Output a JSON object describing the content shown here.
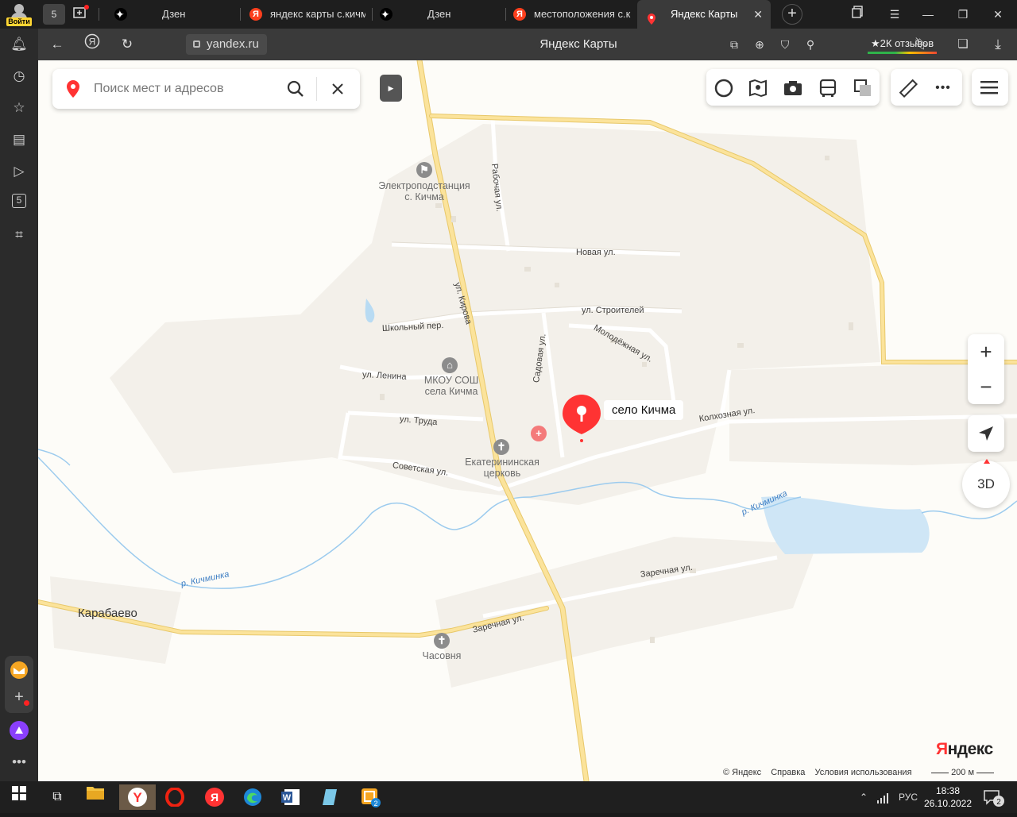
{
  "browser": {
    "profile": {
      "login_label": "Войти"
    },
    "tab_counter": "5",
    "tabs": [
      {
        "title": "Дзен",
        "favicon": "dzen-icon"
      },
      {
        "title": "яндекс карты с.кичм",
        "favicon": "yandex-icon"
      },
      {
        "title": "Дзен",
        "favicon": "dzen-icon"
      },
      {
        "title": "местоположения с.к",
        "favicon": "yandex-icon"
      },
      {
        "title": "Яндекс Карты",
        "favicon": "yandex-maps-icon",
        "active": true
      }
    ],
    "address": {
      "url": "yandex.ru",
      "page_title": "Яндекс Карты",
      "reviews": "★2К отзывов"
    },
    "sidebar_counter": "5"
  },
  "map": {
    "search": {
      "placeholder": "Поиск мест и адресов"
    },
    "selected_place": "село Кичма",
    "zoom_in": "+",
    "zoom_out": "−",
    "mode_3d": "3D",
    "streets": [
      {
        "id": "rabochaya",
        "label": "Рабочая ул."
      },
      {
        "id": "novaya",
        "label": "Новая ул."
      },
      {
        "id": "kirova",
        "label": "ул. Кирова"
      },
      {
        "id": "stroiteley",
        "label": "ул. Строителей"
      },
      {
        "id": "shkolny",
        "label": "Школьный пер."
      },
      {
        "id": "molodezhnaya",
        "label": "Молодёжная ул."
      },
      {
        "id": "sadovaya",
        "label": "Садовая ул."
      },
      {
        "id": "lenina",
        "label": "ул. Ленина"
      },
      {
        "id": "truda",
        "label": "ул. Труда"
      },
      {
        "id": "kolkhoznaya",
        "label": "Колхозная ул."
      },
      {
        "id": "sovetskaya",
        "label": "Советская ул."
      },
      {
        "id": "zarechnaya1",
        "label": "Заречная ул."
      },
      {
        "id": "zarechnaya2",
        "label": "Заречная ул."
      }
    ],
    "rivers": [
      {
        "id": "kichminka1",
        "label": "р. Кичминка"
      },
      {
        "id": "kichminka2",
        "label": "р. Кичминка"
      }
    ],
    "pois": [
      {
        "id": "substation",
        "line1": "Электроподстанция",
        "line2": "с. Кичма",
        "icon": "flag-icon"
      },
      {
        "id": "school",
        "line1": "МКОУ СОШ",
        "line2": "села Кичма",
        "icon": "school-icon"
      },
      {
        "id": "church",
        "line1": "Екатерининская",
        "line2": "церковь",
        "icon": "church-icon"
      },
      {
        "id": "chapel",
        "line1": "Часовня",
        "line2": "",
        "icon": "church-icon"
      }
    ],
    "villages": [
      {
        "id": "karabaevo",
        "label": "Карабаево"
      }
    ],
    "footer": {
      "logo_ya": "Я",
      "logo_rest": "ндекс",
      "copyright": "© Яндекс",
      "help": "Справка",
      "terms": "Условия использования",
      "scale": "200 м"
    },
    "colors": {
      "background": "#fdfcf8",
      "settlement": "#f2efe8",
      "main_road": "#fbe39b",
      "road_edge": "#e8c86a",
      "water": "#cfe6f6",
      "river_line": "#8cc3ea",
      "marker": "#ff3333"
    }
  },
  "taskbar": {
    "language": "РУС",
    "time": "18:38",
    "date": "26.10.2022",
    "notifications": "2",
    "app_badge": "2"
  }
}
